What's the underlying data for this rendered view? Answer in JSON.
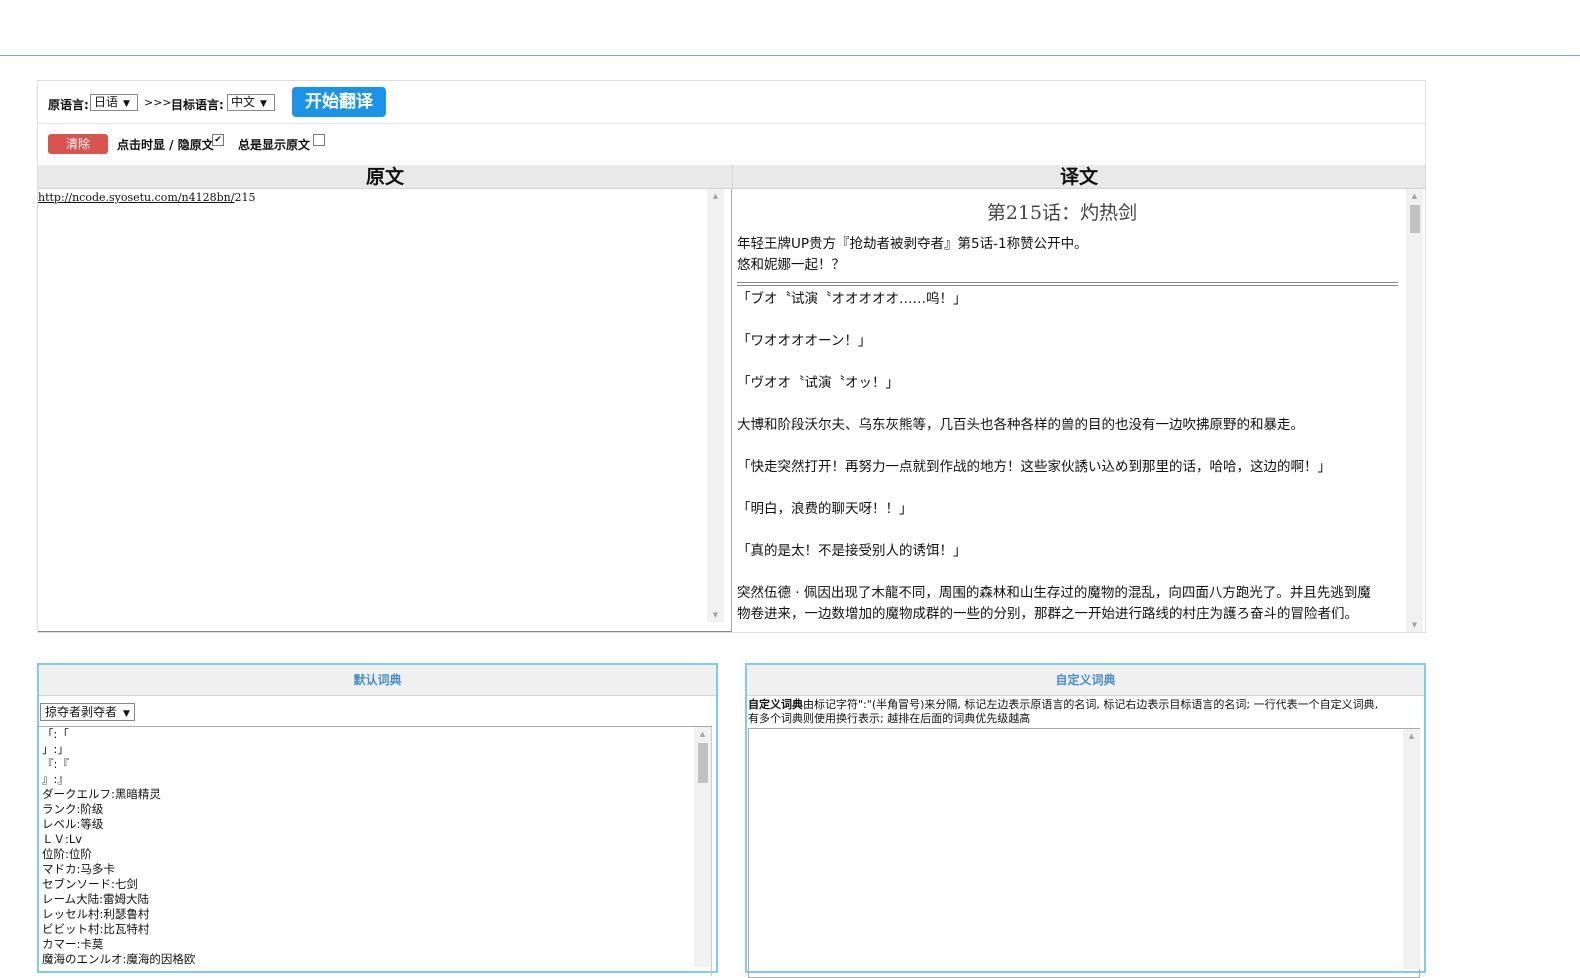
{
  "toolbar": {
    "source_lang_label": "原语言:",
    "source_lang_value": "日语",
    "arrow_text": ">>>",
    "target_lang_label": "目标语言:",
    "target_lang_value": "中文",
    "start_button": "开始翻译",
    "clear_button": "清除",
    "toggle_label": "点击时显 / 隐原文",
    "toggle_checked": true,
    "always_show_label": "总是显示原文",
    "always_show_checked": false
  },
  "columns": {
    "source_header": "原文",
    "target_header": "译文"
  },
  "source": {
    "url_text": "http://ncode.syosetu.com/n4128bn/",
    "url_suffix": "215"
  },
  "translation": {
    "title": "第215话：灼热剑",
    "intro": [
      "年轻王牌UP贵方『抢劫者被剥夺者』第5话-1称赞公开中。",
      "悠和妮娜一起！？"
    ],
    "paragraphs": [
      "「ブオ〝试演〝オオオオオ……呜！」",
      "「ワオオオオーン！」",
      "「ヴオオ〝试演〝オッ！」",
      "大博和阶段沃尔夫、乌东灰熊等，几百头也各种各样的兽的目的也没有一边吹拂原野的和暴走。",
      "「快走突然打开！再努力一点就到作战的地方！这些家伙誘い込め到那里的话，哈哈，这边的啊！」",
      "「明白，浪费的聊天呀！！」",
      "「真的是太！不是接受别人的诱饵！」",
      "突然伍德 · 佩因出现了木龍不同，周围的森林和山生存过的魔物的混乱，向四面八方跑光了。并且先逃到魔",
      "物卷进来，一边数增加的魔物成群的一些的分别，那群之一开始进行路线的村庄为護ろ奋斗的冒险者们。"
    ]
  },
  "default_dict": {
    "header": "默认词典",
    "selected": "掠夺者剥夺者",
    "entries": [
      "「:「",
      "」:」",
      "『:『",
      "』:』",
      "ダークエルフ:黑暗精灵",
      "ランク:阶级",
      "レベル:等级",
      "ＬＶ:Lv",
      "位阶:位阶",
      "マドカ:马多卡",
      "セブンソード:七剑",
      "レーム大陆:雷姆大陆",
      "レッセル村:利瑟鲁村",
      "ビビット村:比瓦特村",
      "カマー:卡莫",
      "魔海のエンルオ:魔海的因格欧"
    ]
  },
  "custom_dict": {
    "header": "自定义词典",
    "desc_bold": "自定义词典",
    "desc_line1": "由标记字符\":\"(半角冒号)来分隔, 标记左边表示原语言的名词, 标记右边表示目标语言的名词; 一行代表一个自定义词典,",
    "desc_line2": "有多个词典则使用换行表示; 越排在后面的词典优先级越高"
  }
}
